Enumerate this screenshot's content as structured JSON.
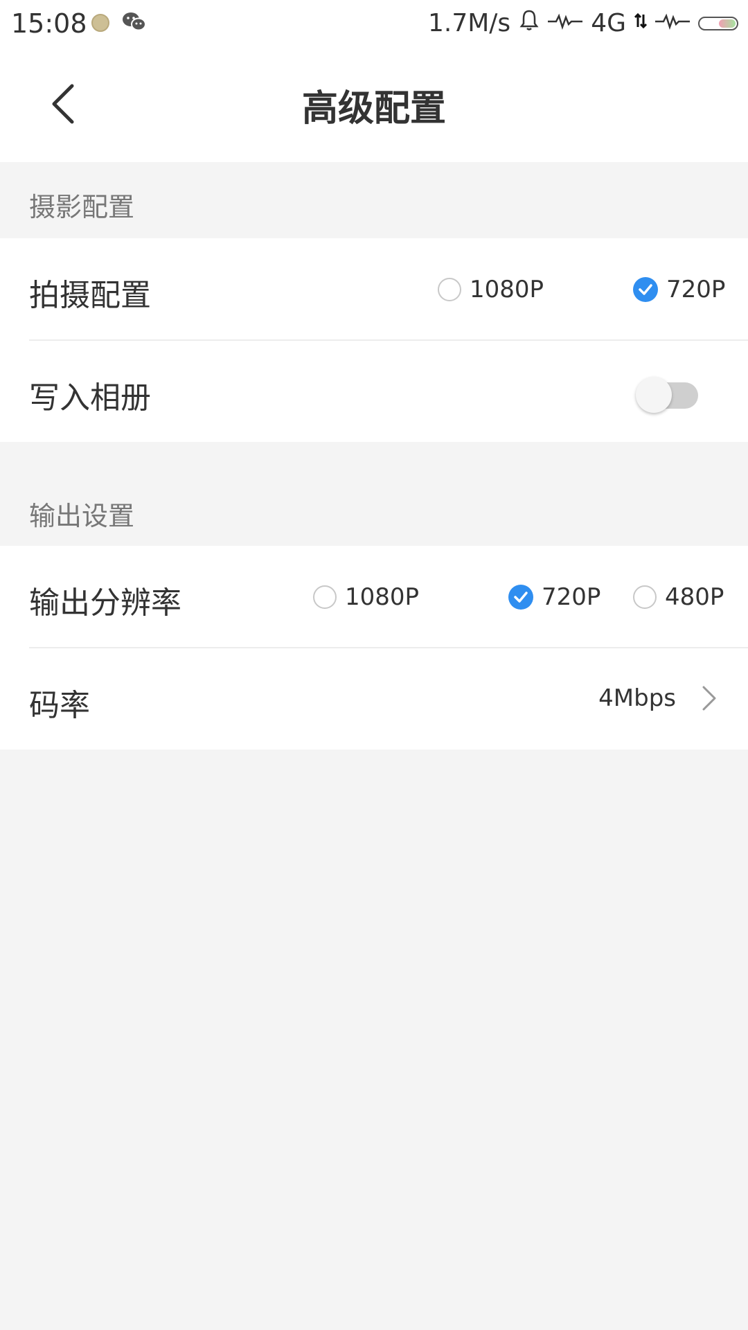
{
  "status_bar": {
    "time": "15:08",
    "network_speed": "1.7M/s",
    "network_type": "4G",
    "icons": [
      "notification-dot-icon",
      "wechat-icon",
      "bell-icon",
      "signal-icon",
      "data-arrows-icon",
      "signal-icon",
      "battery-icon"
    ]
  },
  "nav": {
    "title": "高级配置",
    "back_icon": "chevron-left-icon"
  },
  "sections": {
    "shooting": {
      "header": "摄影配置",
      "capture_label": "拍摄配置",
      "capture_options": [
        "1080P",
        "720P"
      ],
      "capture_selected": "720P",
      "album_label": "写入相册",
      "album_enabled": false
    },
    "output": {
      "header": "输出设置",
      "resolution_label": "输出分辨率",
      "resolution_options": [
        "1080P",
        "720P",
        "480P"
      ],
      "resolution_selected": "720P",
      "bitrate_label": "码率",
      "bitrate_value": "4Mbps"
    }
  },
  "colors": {
    "accent": "#2f8ef0",
    "background": "#f4f4f4",
    "surface": "#ffffff"
  }
}
